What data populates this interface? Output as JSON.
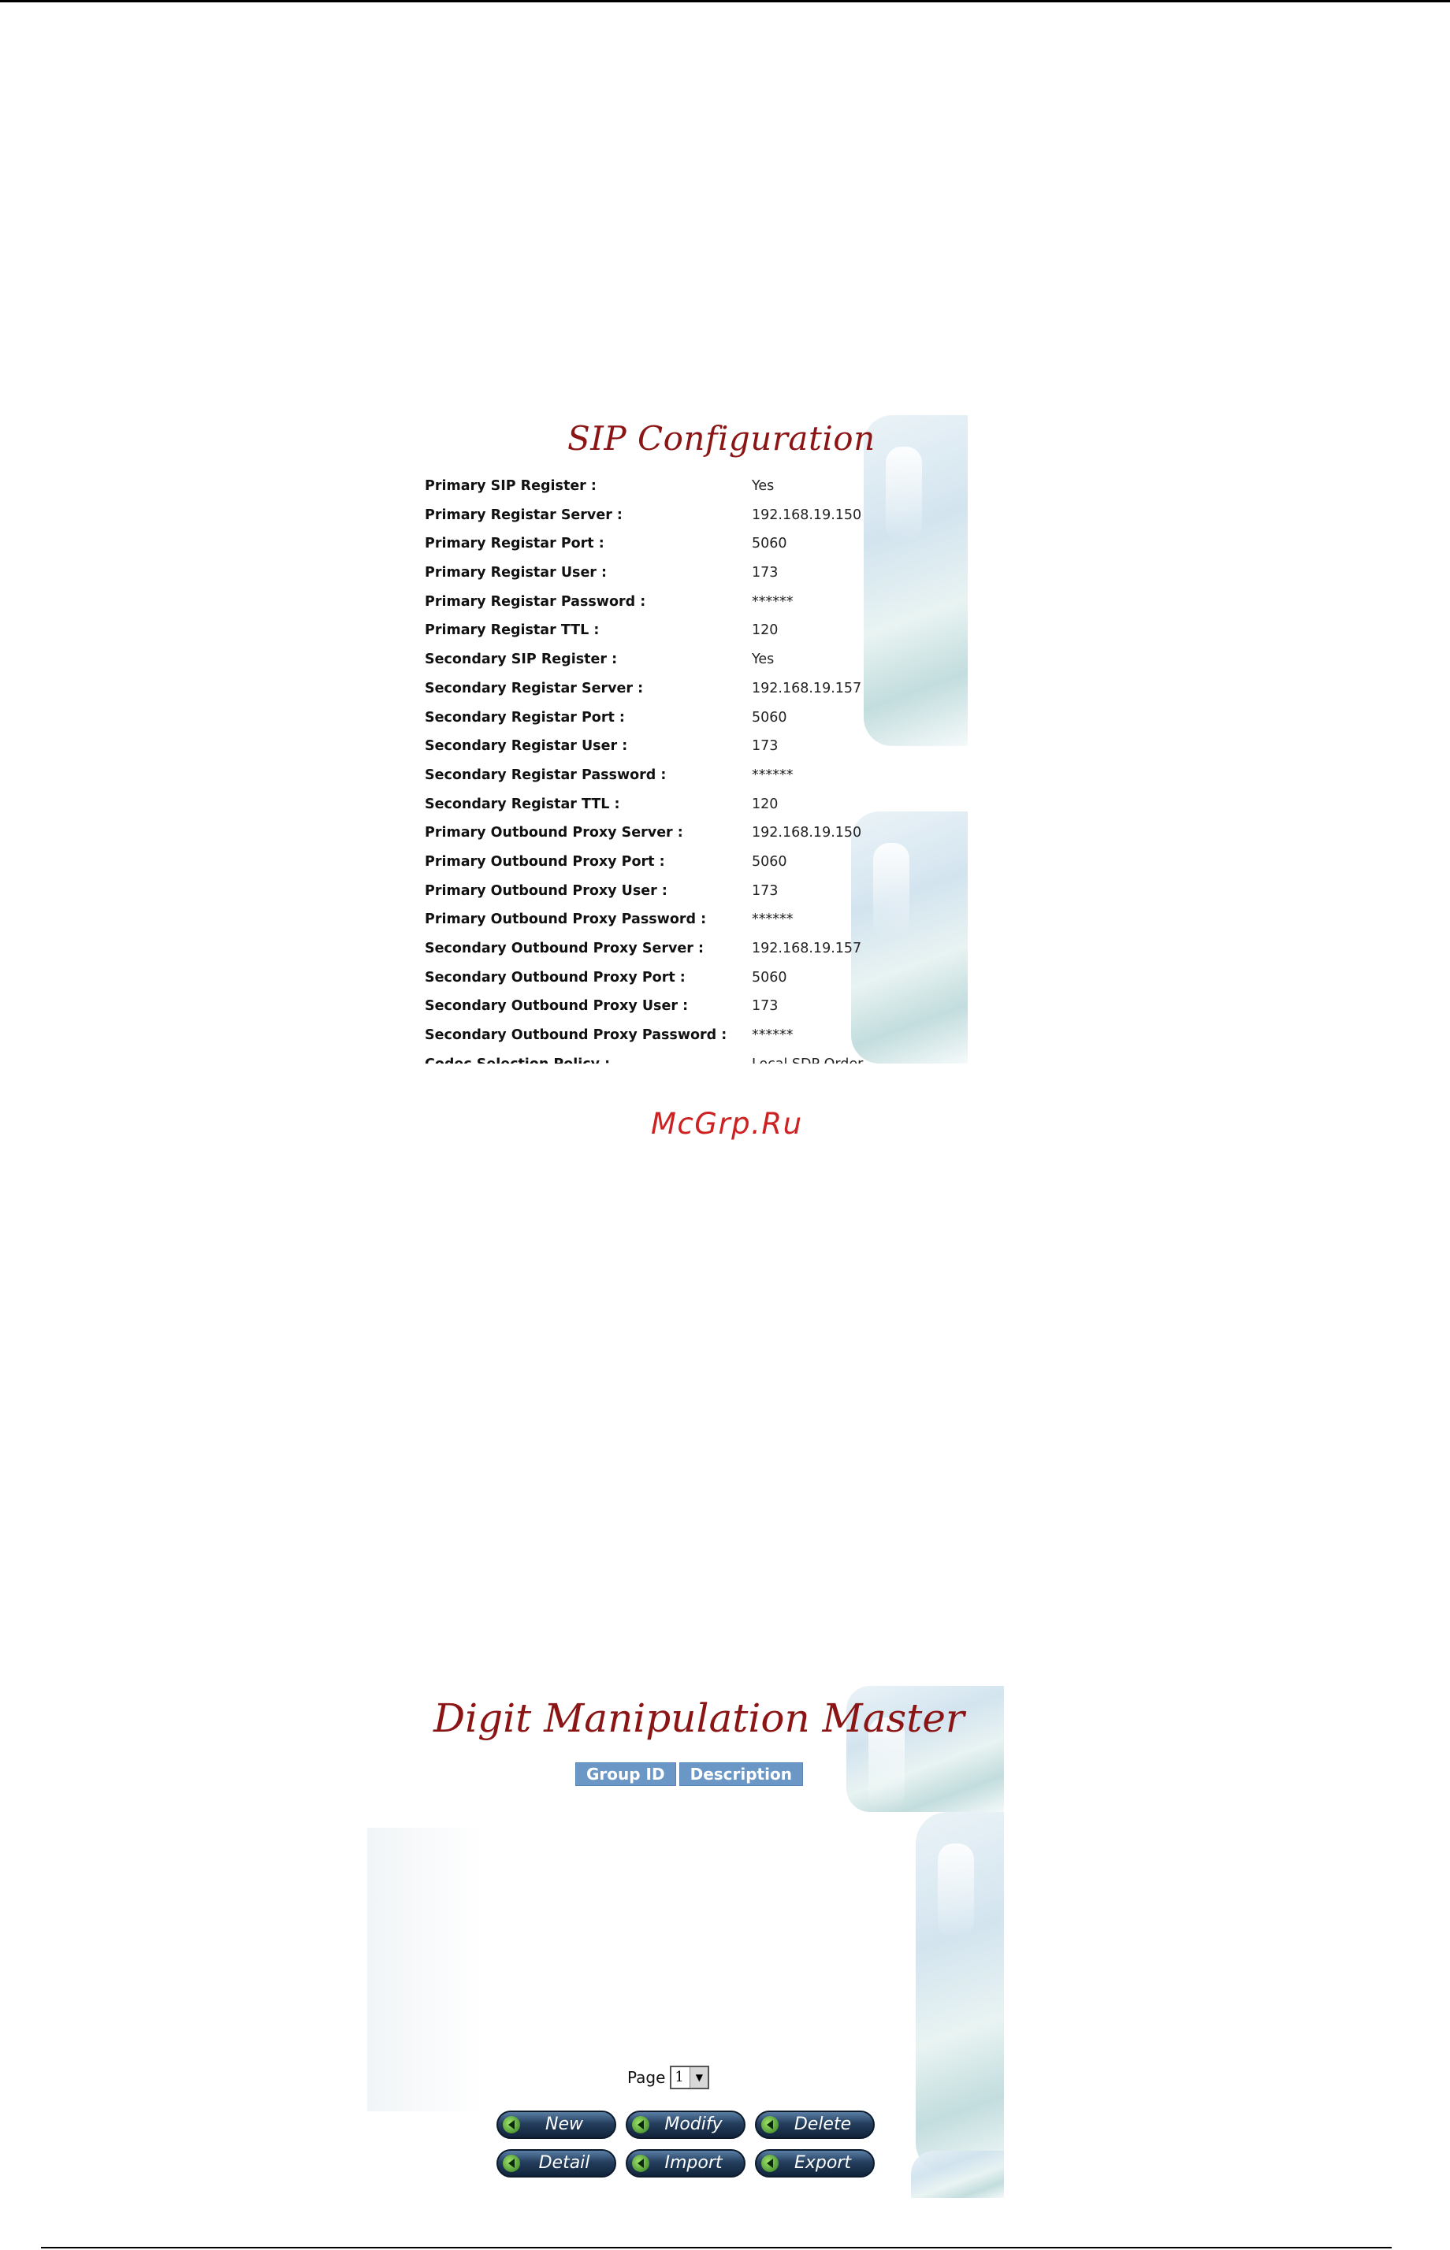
{
  "sip": {
    "title": "SIP Configuration",
    "rows": [
      {
        "label": "Primary SIP Register :",
        "value": "Yes"
      },
      {
        "label": "Primary Registar Server :",
        "value": "192.168.19.150"
      },
      {
        "label": "Primary Registar Port :",
        "value": "5060"
      },
      {
        "label": "Primary Registar User :",
        "value": "173"
      },
      {
        "label": "Primary Registar Password :",
        "value": "******"
      },
      {
        "label": "Primary Registar TTL :",
        "value": "120"
      },
      {
        "label": "Secondary SIP Register :",
        "value": "Yes"
      },
      {
        "label": "Secondary Registar Server :",
        "value": "192.168.19.157"
      },
      {
        "label": "Secondary Registar Port :",
        "value": "5060"
      },
      {
        "label": "Secondary Registar User :",
        "value": "173"
      },
      {
        "label": "Secondary Registar Password :",
        "value": "******"
      },
      {
        "label": "Secondary Registar TTL :",
        "value": "120"
      },
      {
        "label": "Primary Outbound Proxy Server :",
        "value": "192.168.19.150"
      },
      {
        "label": "Primary Outbound Proxy Port :",
        "value": "5060"
      },
      {
        "label": "Primary Outbound Proxy User :",
        "value": "173"
      },
      {
        "label": "Primary Outbound Proxy Password :",
        "value": "******"
      },
      {
        "label": "Secondary Outbound Proxy Server :",
        "value": "192.168.19.157"
      },
      {
        "label": "Secondary Outbound Proxy Port :",
        "value": "5060"
      },
      {
        "label": "Secondary Outbound Proxy User :",
        "value": "173"
      },
      {
        "label": "Secondary Outbound Proxy Password :",
        "value": "******"
      },
      {
        "label": "Codec Selection Policy :",
        "value": "Local SDP Order"
      }
    ]
  },
  "watermark": "McGrp.Ru",
  "digit": {
    "title": "Digit Manipulation Master",
    "columns": [
      "Group ID",
      "Description"
    ],
    "page_label": "Page",
    "page_value": "1",
    "buttons_row1": [
      "New",
      "Modify",
      "Delete"
    ],
    "buttons_row2": [
      "Detail",
      "Import",
      "Export"
    ]
  }
}
